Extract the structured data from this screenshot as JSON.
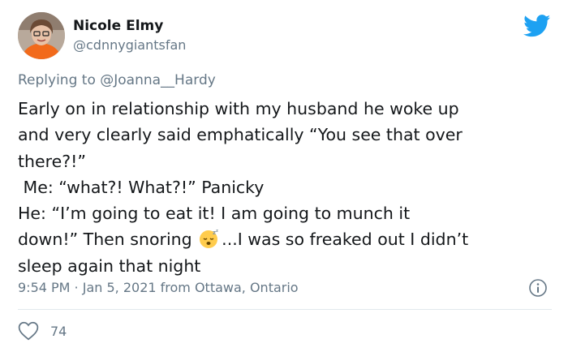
{
  "author": {
    "name": "Nicole Elmy",
    "handle": "@cdnnygiantsfan",
    "avatar_icon": "profile-photo"
  },
  "reply": {
    "prefix": "Replying to ",
    "mention": "@Joanna__Hardy"
  },
  "tweet": {
    "lines": [
      "Early on in relationship with my husband he woke up",
      "and very clearly said emphatically “You see that over",
      "there?!”",
      " Me: “what?! What?!” Panicky",
      "He: “I’m going to eat it! I am going to munch it",
      "down!” Then snoring ",
      "sleep again that night"
    ],
    "line6_after_emoji": "...I was so freaked out I didn’t",
    "emoji": "sleeping-face-emoji"
  },
  "meta": {
    "timestamp": "9:54 PM · Jan 5, 2021 from Ottawa, Ontario"
  },
  "stats": {
    "likes": "74"
  },
  "colors": {
    "text": "#14171a",
    "secondary": "#657786",
    "brand": "#1da1f2",
    "divider": "#e1e8ed"
  },
  "icons": [
    "twitter-bird-icon",
    "info-icon",
    "heart-icon"
  ]
}
